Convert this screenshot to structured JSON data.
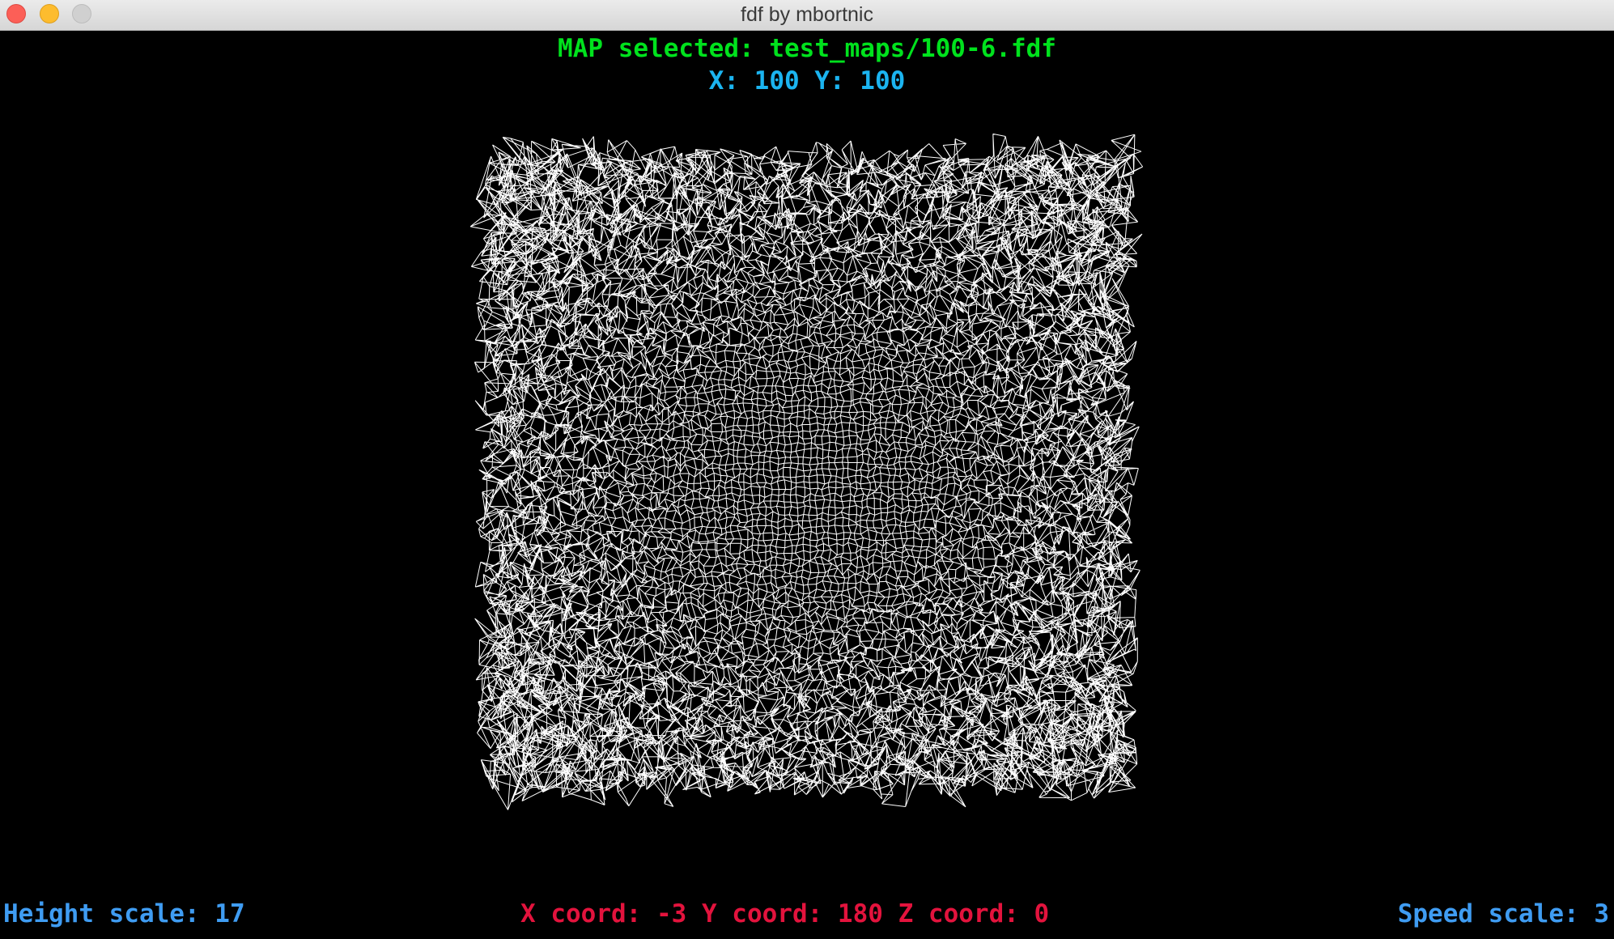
{
  "window": {
    "title": "fdf by mbortnic",
    "buttons": [
      "close",
      "minimize",
      "zoom"
    ]
  },
  "hud": {
    "map_selected": "MAP selected: test_maps/100-6.fdf",
    "map_size": "X: 100 Y: 100",
    "height_scale": "Height scale: 17",
    "coords": "X coord: -3 Y coord: 180 Z coord: 0",
    "speed_scale": "Speed scale: 3"
  },
  "colors": {
    "background": "#000000",
    "wire": "#ffffff",
    "map_text": "#00e21d",
    "size_text": "#1bb4f0",
    "height_text": "#3f9cf2",
    "coords_text": "#e3133d",
    "speed_text": "#3f9cf2"
  },
  "wireframe": {
    "grid_cols": 100,
    "grid_rows": 100
  }
}
